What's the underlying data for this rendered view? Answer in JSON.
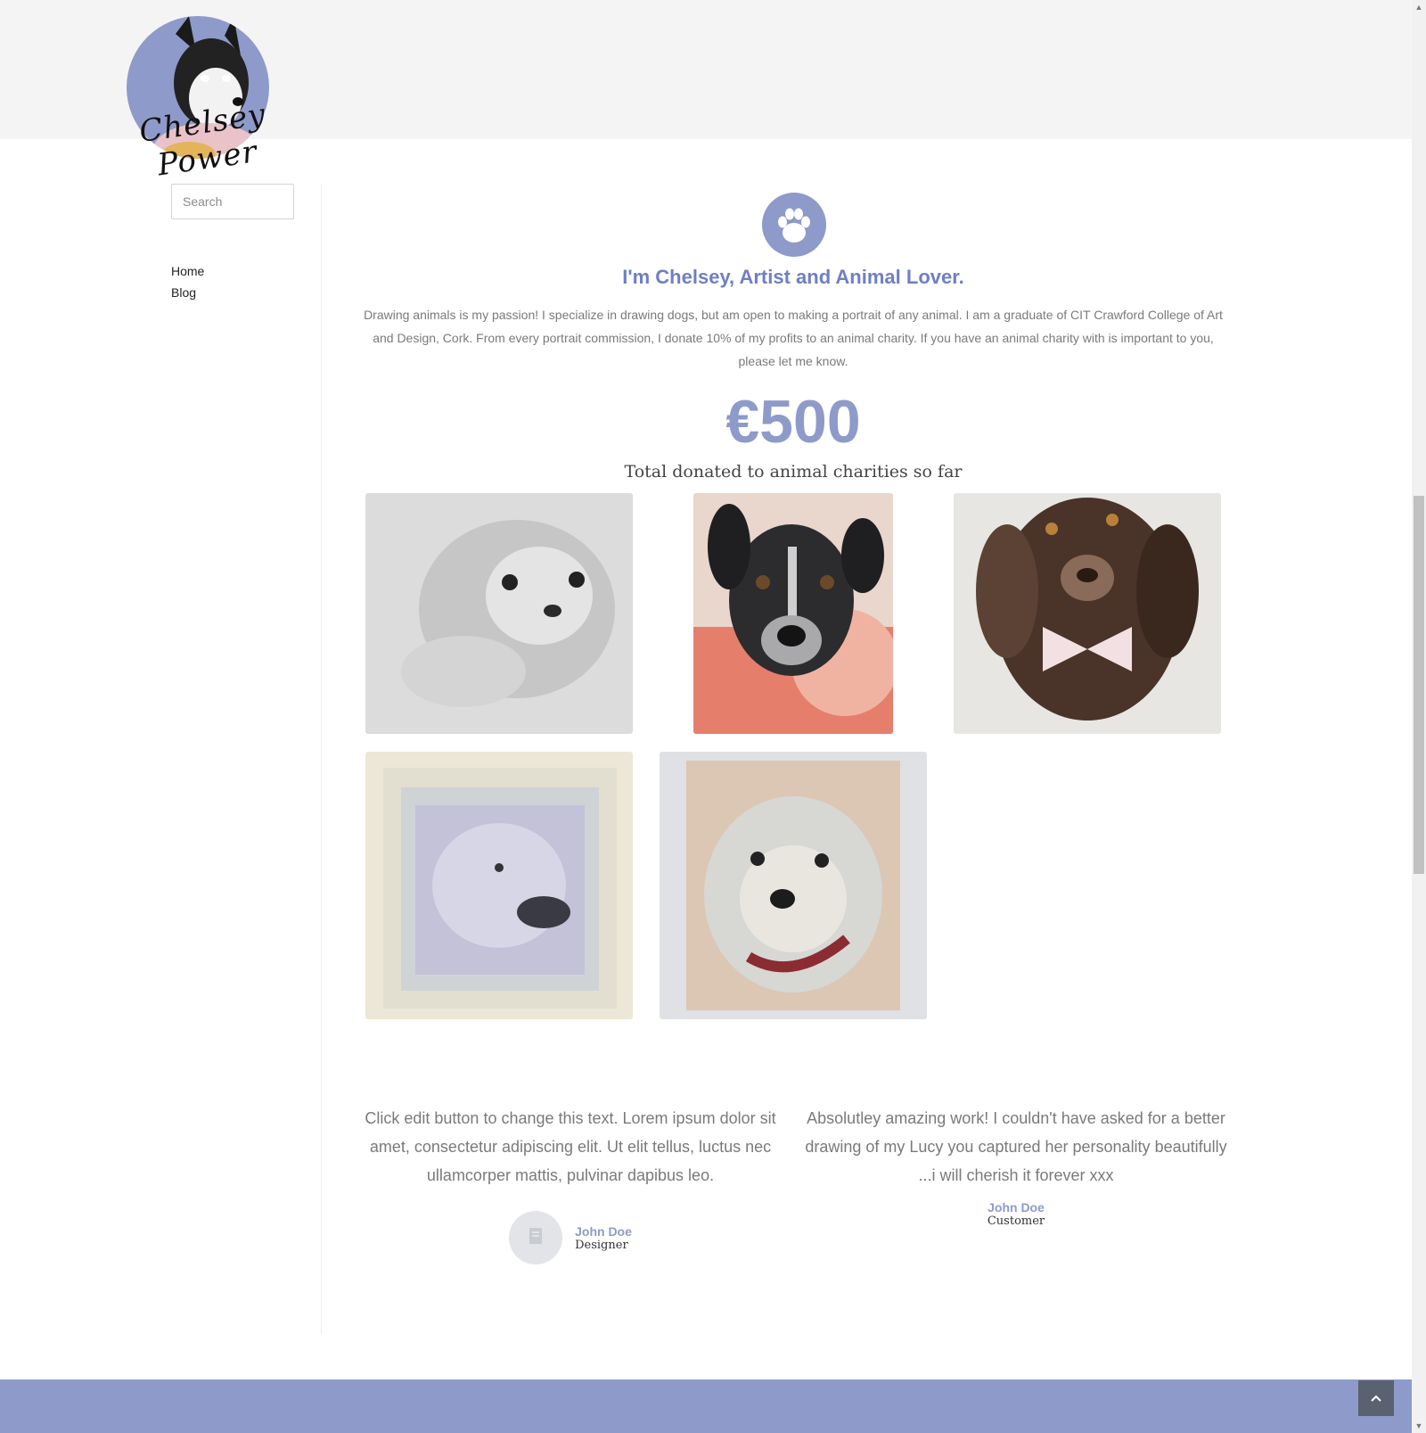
{
  "brand": {
    "logo_text": "Chelsey Power"
  },
  "search": {
    "placeholder": "Search"
  },
  "nav": {
    "items": [
      {
        "label": "Home"
      },
      {
        "label": "Blog"
      }
    ]
  },
  "hero": {
    "headline": "I'm Chelsey, Artist and Animal Lover.",
    "intro": "Drawing animals is my passion! I specialize in drawing dogs, but am open to making a portrait of any animal. I am a graduate of CIT Crawford College of Art and Design, Cork. From every portrait commission, I donate 10% of my profits to an animal charity. If you have an animal charity with is important to you, please let me know.",
    "amount": "€500",
    "amount_caption": "Total donated to animal charities so far"
  },
  "gallery": {
    "images": [
      {
        "subject": "pomeranian pencil drawing"
      },
      {
        "subject": "black and white terrier on pink blanket"
      },
      {
        "subject": "brown spaniel with pink bow tie"
      },
      {
        "subject": "retriever drawing in white frame"
      },
      {
        "subject": "white fluffy dog with red collar"
      }
    ]
  },
  "testimonials": [
    {
      "text": "Click edit button to change this text. Lorem ipsum dolor sit amet, consectetur adipiscing elit. Ut elit tellus, luctus nec ullamcorper mattis, pulvinar dapibus leo.",
      "name": "John Doe",
      "role": "Designer"
    },
    {
      "text": "Absolutley amazing work! I couldn't have asked for a better drawing of my Lucy you captured her personality beautifully ...i will cherish it forever xxx",
      "name": "John Doe",
      "role": "Customer"
    }
  ],
  "colors": {
    "accent": "#8e9ac9",
    "headline": "#6f7fc3",
    "footer": "#8e9ac9",
    "back_to_top": "#5a6170"
  },
  "icons": {
    "paw": "paw-icon",
    "back_to_top": "chevron-up-icon",
    "avatar_placeholder": "image-placeholder-icon"
  }
}
